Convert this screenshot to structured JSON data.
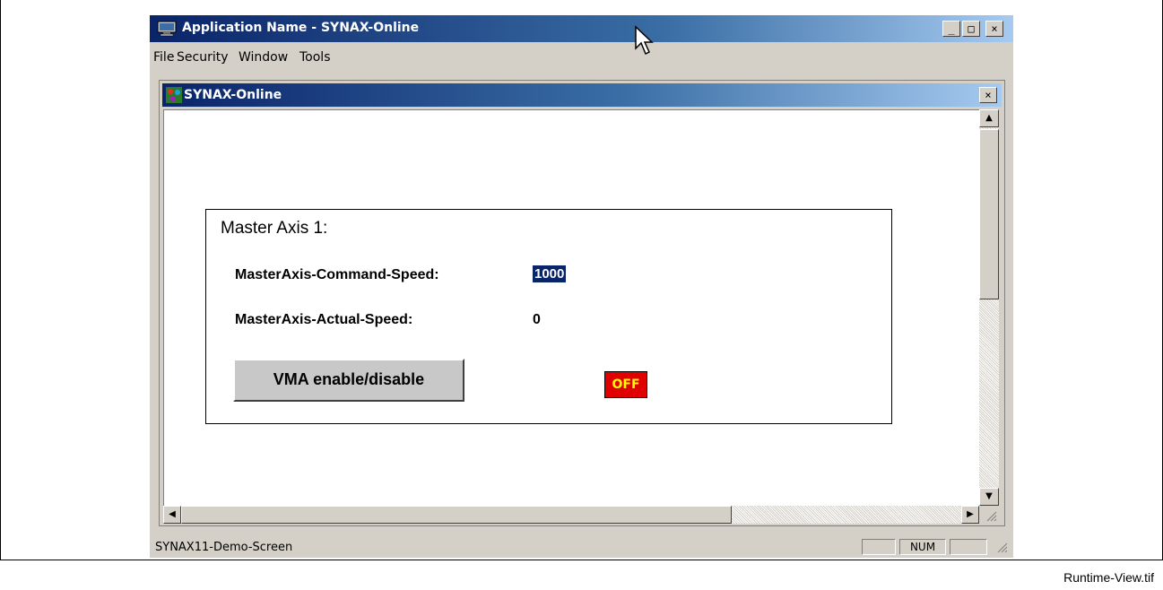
{
  "window": {
    "title": "Application Name - SYNAX-Online",
    "controls": {
      "minimize": "_",
      "maximize": "□",
      "close": "×"
    }
  },
  "menu": [
    "File",
    "Security",
    "Window",
    "Tools"
  ],
  "child_window": {
    "title": "SYNAX-Online",
    "close": "×"
  },
  "group": {
    "title": "Master Axis 1:",
    "command_speed_label": "MasterAxis-Command-Speed:",
    "command_speed_value": "1000",
    "actual_speed_label": "MasterAxis-Actual-Speed:",
    "actual_speed_value": "0",
    "vma_button": "VMA enable/disable",
    "status_indicator": "OFF",
    "status_colors": {
      "background": "#e00000",
      "text": "#ffff00"
    }
  },
  "statusbar": {
    "text": "SYNAX11-Demo-Screen",
    "num": "NUM"
  },
  "scroll": {
    "up": "▲",
    "down": "▼",
    "left": "◀",
    "right": "▶"
  },
  "caption": "Runtime-View.tif"
}
